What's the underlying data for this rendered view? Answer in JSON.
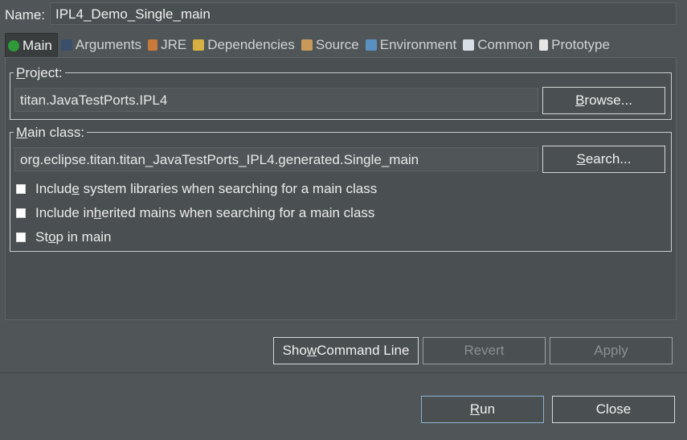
{
  "name": {
    "label": "Name:",
    "value": "IPL4_Demo_Single_main"
  },
  "tabs": [
    {
      "label": "Main",
      "icon": "main-icon",
      "active": true,
      "color": "#2f9a3a"
    },
    {
      "label": "Arguments",
      "icon": "arguments-icon",
      "color": "#3a4f6b"
    },
    {
      "label": "JRE",
      "icon": "jre-icon",
      "color": "#c87a3a"
    },
    {
      "label": "Dependencies",
      "icon": "dependencies-icon",
      "color": "#d6b040"
    },
    {
      "label": "Source",
      "icon": "source-icon",
      "color": "#c79a5a"
    },
    {
      "label": "Environment",
      "icon": "environment-icon",
      "color": "#5a8fc2"
    },
    {
      "label": "Common",
      "icon": "common-icon",
      "color": "#d9dfe6"
    },
    {
      "label": "Prototype",
      "icon": "prototype-icon",
      "color": "#e6e6e6"
    }
  ],
  "project": {
    "title_underlined": "P",
    "title_rest": "roject:",
    "value": "titan.JavaTestPorts.IPL4",
    "browse_u": "B",
    "browse_rest": "rowse..."
  },
  "main_class": {
    "title_underlined": "M",
    "title_rest": "ain class:",
    "value": "org.eclipse.titan.titan_JavaTestPorts_IPL4.generated.Single_main",
    "search_u": "S",
    "search_rest": "earch..."
  },
  "options": [
    {
      "pre": "Includ",
      "u": "e",
      "post": " system libraries when searching for a main class"
    },
    {
      "pre": "Include in",
      "u": "h",
      "post": "erited mains when searching for a main class"
    },
    {
      "pre": "St",
      "u": "o",
      "post": "p in main"
    }
  ],
  "buttons": {
    "show_cmd_pre": "Sho",
    "show_cmd_u": "w",
    "show_cmd_post": " Command Line",
    "revert": "Revert",
    "apply": "Apply",
    "run_u": "R",
    "run_rest": "un",
    "close": "Close"
  }
}
